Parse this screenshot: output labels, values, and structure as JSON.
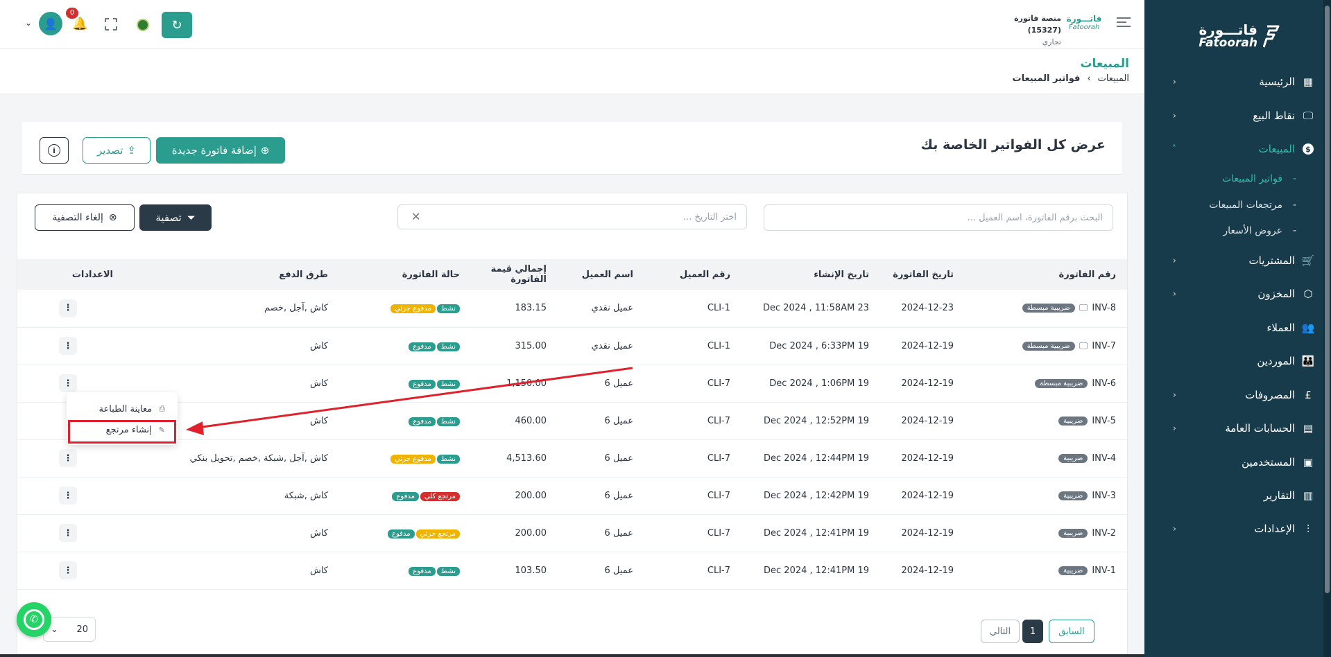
{
  "sidebar": {
    "logo_ar": "فاتـــورة",
    "logo_en": "Fatoorah",
    "items": [
      {
        "label": "الرئيسية",
        "icon": "grid-icon"
      },
      {
        "label": "نقاط البيع",
        "icon": "monitor-icon"
      },
      {
        "label": "المبيعات",
        "icon": "dollar-icon"
      },
      {
        "label": "المشتريات",
        "icon": "cart-icon"
      },
      {
        "label": "المخزون",
        "icon": "box-icon"
      },
      {
        "label": "العملاء",
        "icon": "users-icon"
      },
      {
        "label": "الموردين",
        "icon": "group-icon"
      },
      {
        "label": "المصروفات",
        "icon": "pound-icon"
      },
      {
        "label": "الحسابات العامة",
        "icon": "calculator-icon"
      },
      {
        "label": "المستخدمين",
        "icon": "user-badge-icon"
      },
      {
        "label": "التقارير",
        "icon": "bar-chart-icon"
      },
      {
        "label": "الإعدادات",
        "icon": "sliders-icon"
      }
    ],
    "sub_items": [
      {
        "label": "فواتير المبيعات"
      },
      {
        "label": "مرتجعات المبيعات"
      },
      {
        "label": "عروض الأسعار"
      }
    ]
  },
  "topbar": {
    "brand_ar": "فاتـــورة",
    "brand_en": "Fatoorah",
    "platform_name": "منصة فاتورة",
    "platform_id": "(15327)",
    "platform_type": "تجاري",
    "notification_count": "0"
  },
  "page": {
    "title": "المبيعات",
    "breadcrumb_root": "المبيعات",
    "breadcrumb_current": "فواتير المبيعات"
  },
  "card": {
    "title": "عرض كل الفواتير الخاصة بك",
    "add_label": "إضافة فاتورة جديدة",
    "export_label": "تصدير"
  },
  "filters": {
    "search_placeholder": "البحث برقم الفاتورة، اسم العميل ...",
    "date_placeholder": "اختر التاريخ ...",
    "filter_label": "تصفية",
    "clear_label": "إلغاء التصفية"
  },
  "table": {
    "headers": [
      "رقم الفاتورة",
      "تاريخ الفاتورة",
      "تاريخ الإنشاء",
      "رقم العميل",
      "اسم العميل",
      "إجمالي قيمة الفاتورة",
      "حالة الفاتورة",
      "طرق الدفع",
      "الاعدادات"
    ],
    "rows": [
      {
        "num": "INV-8",
        "badge": "ضريبية مبسطة",
        "date": "2024-12-23",
        "created": "23 Dec 2024 , 11:58AM",
        "client": "CLI-1",
        "name": "عميل نقدي",
        "total": "183.15",
        "s1": "نشط",
        "s2": "مدفوع جزئي",
        "pay": "كاش ,آجل ,خصم"
      },
      {
        "num": "INV-7",
        "badge": "ضريبية مبسطة",
        "date": "2024-12-19",
        "created": "19 Dec 2024 , 6:33PM",
        "client": "CLI-1",
        "name": "عميل نقدي",
        "total": "315.00",
        "s1": "نشط",
        "s2": "مدفوع",
        "pay": "كاش"
      },
      {
        "num": "INV-6",
        "badge": "ضريبية مبسطة",
        "date": "2024-12-19",
        "created": "19 Dec 2024 , 1:06PM",
        "client": "CLI-7",
        "name": "عميل 6",
        "total": "1,150.00",
        "s1": "نشط",
        "s2": "مدفوع",
        "pay": "كاش"
      },
      {
        "num": "INV-5",
        "badge": "ضريبية",
        "date": "2024-12-19",
        "created": "19 Dec 2024 , 12:52PM",
        "client": "CLI-7",
        "name": "عميل 6",
        "total": "460.00",
        "s1": "نشط",
        "s2": "مدفوع",
        "pay": "كاش"
      },
      {
        "num": "INV-4",
        "badge": "ضريبية",
        "date": "2024-12-19",
        "created": "19 Dec 2024 , 12:44PM",
        "client": "CLI-7",
        "name": "عميل 6",
        "total": "4,513.60",
        "s1": "نشط",
        "s2": "مدفوع جزئي",
        "pay": "كاش ,آجل ,شبكة ,خصم ,تحويل بنكي"
      },
      {
        "num": "INV-3",
        "badge": "ضريبية",
        "date": "2024-12-19",
        "created": "19 Dec 2024 , 12:42PM",
        "client": "CLI-7",
        "name": "عميل 6",
        "total": "200.00",
        "s1": "مرتجع كلي",
        "s2": "مدفوع",
        "pay": "كاش ,شبكة"
      },
      {
        "num": "INV-2",
        "badge": "ضريبية",
        "date": "2024-12-19",
        "created": "19 Dec 2024 , 12:41PM",
        "client": "CLI-7",
        "name": "عميل 6",
        "total": "200.00",
        "s1": "مرتجع جزئي",
        "s2": "مدفوع",
        "pay": "كاش"
      },
      {
        "num": "INV-1",
        "badge": "ضريبية",
        "date": "2024-12-19",
        "created": "19 Dec 2024 , 12:41PM",
        "client": "CLI-7",
        "name": "عميل 6",
        "total": "103.50",
        "s1": "نشط",
        "s2": "مدفوع",
        "pay": "كاش"
      }
    ]
  },
  "row_menu": {
    "print_preview": "معاينة الطباعة",
    "create_return": "إنشاء مرتجع"
  },
  "pagination": {
    "prev": "السابق",
    "current": "1",
    "next": "التالي",
    "page_size": "20"
  },
  "colors": {
    "sidebar": "#173b4a",
    "accent": "#2a9d8f",
    "active_nav": "#2fbfa7",
    "status_green": "#2a9d8f",
    "status_yellow": "#f0b400",
    "status_red": "#d32f2f",
    "annotation_red": "#e0212b"
  }
}
